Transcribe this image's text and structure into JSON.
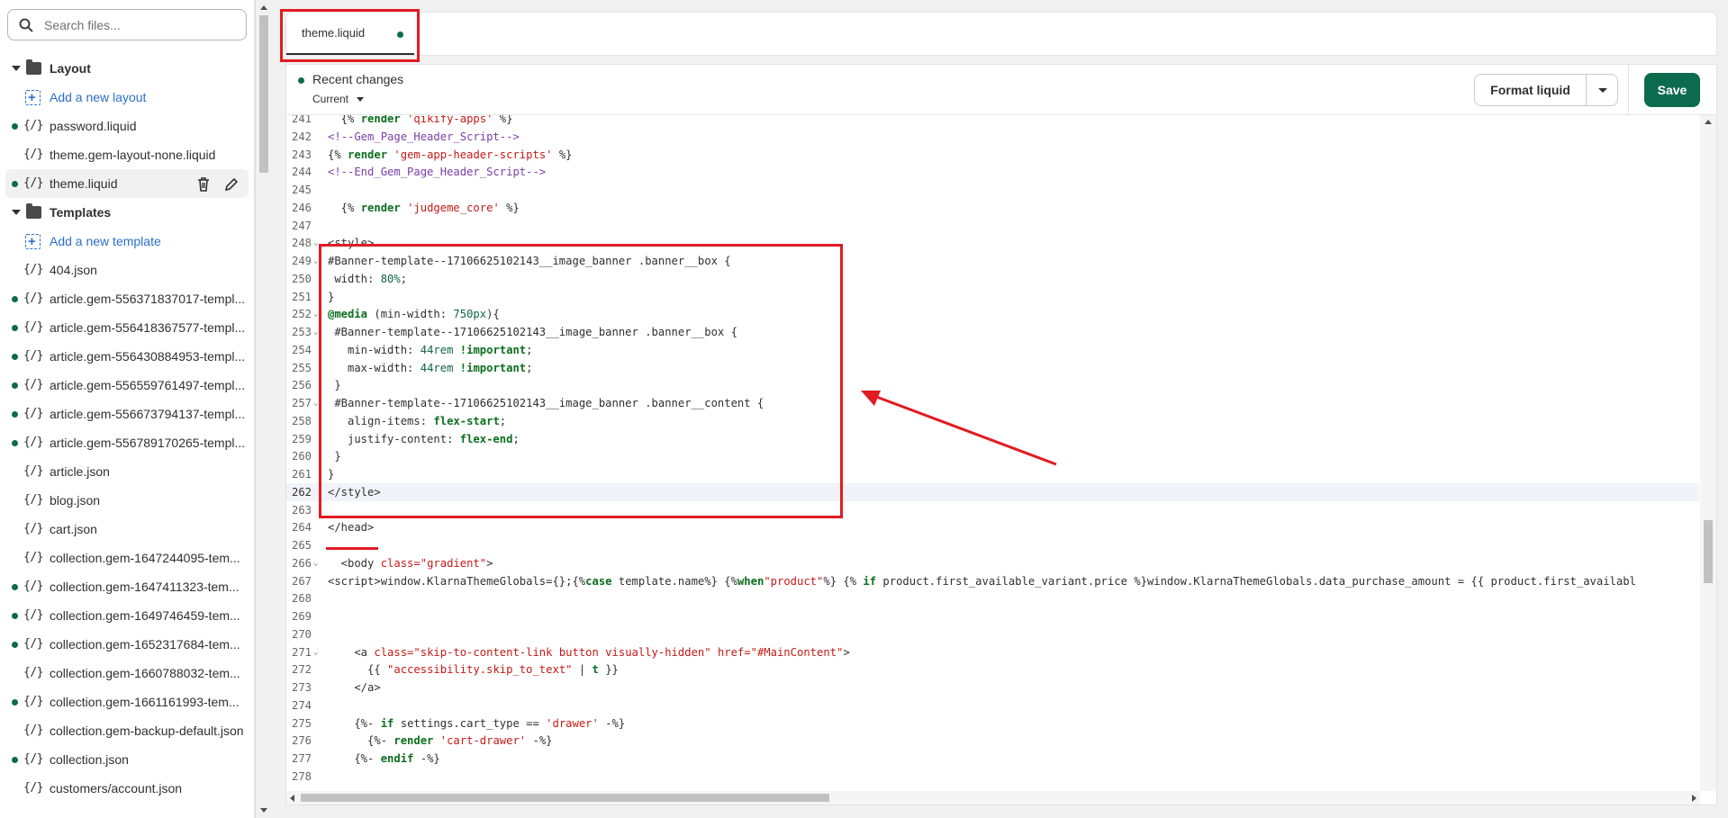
{
  "sidebar": {
    "search_placeholder": "Search files...",
    "items": [
      {
        "type": "folder",
        "label": "Layout"
      },
      {
        "type": "add",
        "label": "Add a new layout"
      },
      {
        "type": "file",
        "label": "password.liquid",
        "dot": true
      },
      {
        "type": "file",
        "label": "theme.gem-layout-none.liquid",
        "dot": false
      },
      {
        "type": "file",
        "label": "theme.liquid",
        "dot": true,
        "active": true
      },
      {
        "type": "folder",
        "label": "Templates"
      },
      {
        "type": "add",
        "label": "Add a new template"
      },
      {
        "type": "file",
        "label": "404.json",
        "dot": false
      },
      {
        "type": "file",
        "label": "article.gem-556371837017-templ...",
        "dot": true
      },
      {
        "type": "file",
        "label": "article.gem-556418367577-templ...",
        "dot": true
      },
      {
        "type": "file",
        "label": "article.gem-556430884953-templ...",
        "dot": true
      },
      {
        "type": "file",
        "label": "article.gem-556559761497-templ...",
        "dot": true
      },
      {
        "type": "file",
        "label": "article.gem-556673794137-templ...",
        "dot": true
      },
      {
        "type": "file",
        "label": "article.gem-556789170265-templ...",
        "dot": true
      },
      {
        "type": "file",
        "label": "article.json",
        "dot": false
      },
      {
        "type": "file",
        "label": "blog.json",
        "dot": false
      },
      {
        "type": "file",
        "label": "cart.json",
        "dot": false
      },
      {
        "type": "file",
        "label": "collection.gem-1647244095-tem...",
        "dot": false
      },
      {
        "type": "file",
        "label": "collection.gem-1647411323-tem...",
        "dot": true
      },
      {
        "type": "file",
        "label": "collection.gem-1649746459-tem...",
        "dot": true
      },
      {
        "type": "file",
        "label": "collection.gem-1652317684-tem...",
        "dot": true
      },
      {
        "type": "file",
        "label": "collection.gem-1660788032-tem...",
        "dot": false
      },
      {
        "type": "file",
        "label": "collection.gem-1661161993-tem...",
        "dot": true
      },
      {
        "type": "file",
        "label": "collection.gem-backup-default.json",
        "dot": false
      },
      {
        "type": "file",
        "label": "collection.json",
        "dot": true
      },
      {
        "type": "file",
        "label": "customers/account.json",
        "dot": false
      }
    ],
    "file_icon": "{/}",
    "icons": {
      "search": "search-icon",
      "delete": "trash-icon",
      "rename": "pencil-icon"
    }
  },
  "tabs": [
    {
      "label": "theme.liquid",
      "unsaved": true
    }
  ],
  "toolbar": {
    "recent_changes": "Recent changes",
    "current": "Current",
    "format": "Format liquid",
    "save": "Save"
  },
  "colors": {
    "accent": "#0d6b4d",
    "annotation": "#e21b23",
    "link": "#2c6ecb"
  },
  "code": {
    "current_line": 262,
    "lines": [
      {
        "n": 241,
        "fold": false,
        "html": "  {% <span class=\"k\">render</span> <span class=\"s\">'qikify-apps'</span> %}"
      },
      {
        "n": 242,
        "fold": false,
        "html": "<span class=\"c\">&lt;!--Gem_Page_Header_Script--&gt;</span>"
      },
      {
        "n": 243,
        "fold": false,
        "html": "{% <span class=\"k\">render</span> <span class=\"s\">'gem-app-header-scripts'</span> %}"
      },
      {
        "n": 244,
        "fold": false,
        "html": "<span class=\"c\">&lt;!--End_Gem_Page_Header_Script--&gt;</span>"
      },
      {
        "n": 245,
        "fold": false,
        "html": ""
      },
      {
        "n": 246,
        "fold": false,
        "html": "  {% <span class=\"k\">render</span> <span class=\"s\">'judgeme_core'</span> %}"
      },
      {
        "n": 247,
        "fold": false,
        "html": ""
      },
      {
        "n": 248,
        "fold": true,
        "html": "&lt;style&gt;"
      },
      {
        "n": 249,
        "fold": true,
        "html": "#Banner-template--17106625102143__image_banner .banner__box {"
      },
      {
        "n": 250,
        "fold": false,
        "html": " width: <span class=\"n\">80%</span>;"
      },
      {
        "n": 251,
        "fold": false,
        "html": "}"
      },
      {
        "n": 252,
        "fold": true,
        "html": "<span class=\"k\">@media</span> (min-width: <span class=\"n\">750px</span>){"
      },
      {
        "n": 253,
        "fold": true,
        "html": " #Banner-template--17106625102143__image_banner .banner__box {"
      },
      {
        "n": 254,
        "fold": false,
        "html": "   min-width: <span class=\"n\">44rem</span> <span class=\"k\">!important</span>;"
      },
      {
        "n": 255,
        "fold": false,
        "html": "   max-width: <span class=\"n\">44rem</span> <span class=\"k\">!important</span>;"
      },
      {
        "n": 256,
        "fold": false,
        "html": " }"
      },
      {
        "n": 257,
        "fold": true,
        "html": " #Banner-template--17106625102143__image_banner .banner__content {"
      },
      {
        "n": 258,
        "fold": false,
        "html": "   align-items: <span class=\"k\">flex-start</span>;"
      },
      {
        "n": 259,
        "fold": false,
        "html": "   justify-content: <span class=\"k\">flex-end</span>;"
      },
      {
        "n": 260,
        "fold": false,
        "html": " }"
      },
      {
        "n": 261,
        "fold": false,
        "html": "}"
      },
      {
        "n": 262,
        "fold": false,
        "html": "&lt;/style&gt;"
      },
      {
        "n": 263,
        "fold": false,
        "html": ""
      },
      {
        "n": 264,
        "fold": false,
        "html": "&lt;/head&gt;"
      },
      {
        "n": 265,
        "fold": false,
        "html": ""
      },
      {
        "n": 266,
        "fold": true,
        "html": "  &lt;body <span class=\"s\">class=\"gradient\"</span>&gt;"
      },
      {
        "n": 267,
        "fold": false,
        "html": "&lt;script&gt;window.KlarnaThemeGlobals={};{%<span class=\"k\">case</span> template.name%} {%<span class=\"k\">when</span><span class=\"s\">\"product\"</span>%} {% <span class=\"k\">if</span> product.first_available_variant.price %}window.KlarnaThemeGlobals.data_purchase_amount = {{ product.first_availabl"
      },
      {
        "n": 268,
        "fold": false,
        "html": ""
      },
      {
        "n": 269,
        "fold": false,
        "html": ""
      },
      {
        "n": 270,
        "fold": false,
        "html": ""
      },
      {
        "n": 271,
        "fold": true,
        "html": "    &lt;a <span class=\"s\">class=\"skip-to-content-link button visually-hidden\"</span> <span class=\"s\">href=\"#MainContent\"</span>&gt;"
      },
      {
        "n": 272,
        "fold": false,
        "html": "      {{ <span class=\"s\">\"accessibility.skip_to_text\"</span> | <span class=\"k\">t</span> }}"
      },
      {
        "n": 273,
        "fold": false,
        "html": "    &lt;/a&gt;"
      },
      {
        "n": 274,
        "fold": false,
        "html": ""
      },
      {
        "n": 275,
        "fold": false,
        "html": "    {%- <span class=\"k\">if</span> settings.cart_type == <span class=\"s\">'drawer'</span> -%}"
      },
      {
        "n": 276,
        "fold": false,
        "html": "      {%- <span class=\"k\">render</span> <span class=\"s\">'cart-drawer'</span> -%}"
      },
      {
        "n": 277,
        "fold": false,
        "html": "    {%- <span class=\"k\">endif</span> -%}"
      },
      {
        "n": 278,
        "fold": false,
        "html": ""
      }
    ]
  }
}
